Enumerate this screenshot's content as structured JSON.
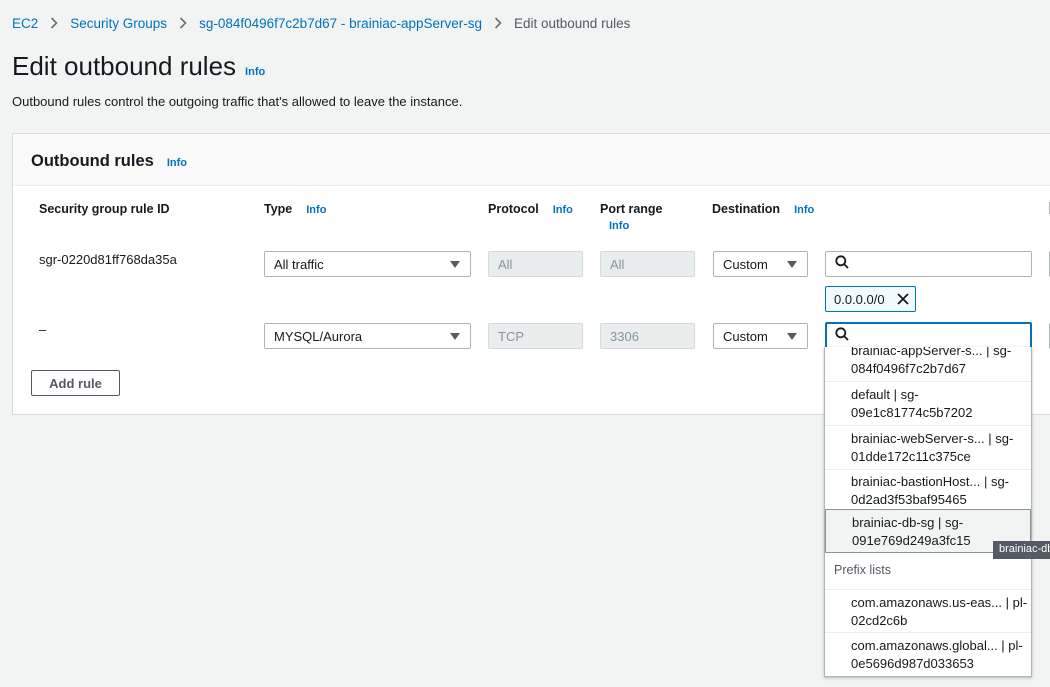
{
  "breadcrumb": {
    "items": [
      "EC2",
      "Security Groups",
      "sg-084f0496f7c2b7d67 - brainiac-appServer-sg"
    ],
    "current": "Edit outbound rules"
  },
  "page": {
    "title": "Edit outbound rules",
    "info": "Info",
    "description": "Outbound rules control the outgoing traffic that's allowed to leave the instance."
  },
  "panel": {
    "title": "Outbound rules",
    "info": "Info",
    "columns": {
      "rule_id": "Security group rule ID",
      "type": "Type",
      "protocol": "Protocol",
      "port_range": "Port range",
      "destination": "Destination",
      "info": "Info"
    },
    "rows": [
      {
        "rule_id": "sgr-0220d81ff768da35a",
        "type": "All traffic",
        "protocol": "All",
        "port_range": "All",
        "destination": "Custom",
        "search_value": "",
        "token": "0.0.0.0/0"
      },
      {
        "rule_id": "–",
        "type": "MYSQL/Aurora",
        "protocol": "TCP",
        "port_range": "3306",
        "destination": "Custom",
        "search_value": ""
      }
    ],
    "add_rule": "Add rule"
  },
  "dropdown": {
    "security_groups": [
      {
        "line1": "brainiac-appServer-s... | sg-",
        "line2": "084f0496f7c2b7d67"
      },
      {
        "line1": "default | sg-",
        "line2": "09e1c81774c5b7202"
      },
      {
        "line1": "brainiac-webServer-s... | sg-",
        "line2": "01dde172c11c375ce"
      },
      {
        "line1": "brainiac-bastionHost... | sg-",
        "line2": "0d2ad3f53baf95465"
      },
      {
        "line1": "brainiac-db-sg | sg-",
        "line2": "091e769d249a3fc15"
      }
    ],
    "prefix_label": "Prefix lists",
    "prefix_lists": [
      {
        "line1": "com.amazonaws.us-eas... | pl-",
        "line2": "02cd2c6b"
      },
      {
        "line1": "com.amazonaws.global... | pl-",
        "line2": "0e5696d987d033653"
      }
    ],
    "tooltip": "brainiac-db"
  },
  "colors": {
    "link": "#0073bb",
    "border": "#aab7b8",
    "text": "#16191f"
  }
}
